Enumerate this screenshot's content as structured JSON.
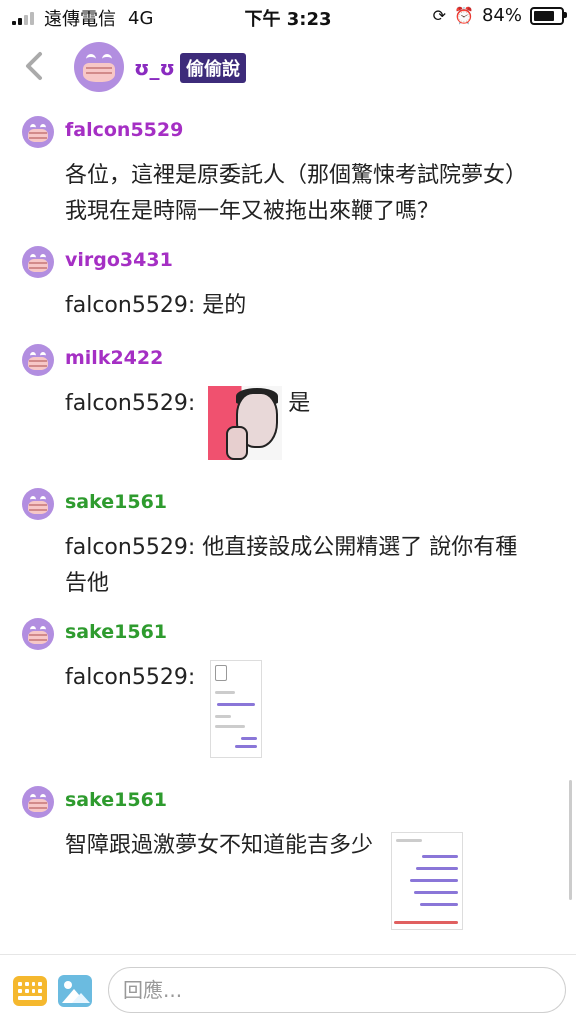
{
  "status_bar": {
    "carrier": "遠傳電信",
    "network": "4G",
    "time": "下午 3:23",
    "battery": "84%",
    "battery_level": 0.84
  },
  "header": {
    "name": "ʊ_ʊ",
    "badge": "偷偷說"
  },
  "messages": [
    {
      "user": "falcon5529",
      "color": "#a52fc4",
      "text": "各位，這裡是原委託人（那個驚悚考試院夢女）我現在是時隔一年又被拖出來鞭了嗎？"
    },
    {
      "user": "virgo3431",
      "color": "#a52fc4",
      "text": "falcon5529: 是的"
    },
    {
      "user": "milk2422",
      "color": "#a52fc4",
      "text_before": "falcon5529: ",
      "text_after": "是"
    },
    {
      "user": "sake1561",
      "color": "#2e9b2e",
      "text": "falcon5529: 他直接設成公開精選了 說你有種告他"
    },
    {
      "user": "sake1561",
      "color": "#2e9b2e",
      "text": "falcon5529: "
    },
    {
      "user": "sake1561",
      "color": "#2e9b2e",
      "text": "智障跟過激夢女不知道能吉多少"
    }
  ],
  "input": {
    "placeholder": "回應..."
  }
}
